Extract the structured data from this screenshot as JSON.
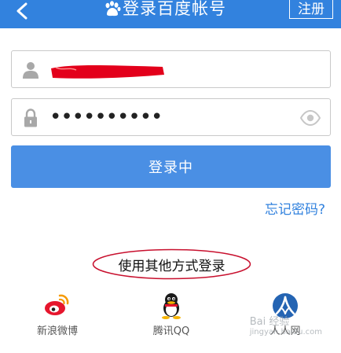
{
  "header": {
    "title": "登录百度帐号",
    "register_label": "注册",
    "background": "#3282de"
  },
  "form": {
    "username_value": "—",
    "password_value": "••••••••••",
    "login_button_label": "登录中",
    "forgot_link": "忘记密码?"
  },
  "other_login": {
    "label": "使用其他方式登录",
    "providers": [
      {
        "name": "新浪微博",
        "icon": "weibo-icon"
      },
      {
        "name": "腾讯QQ",
        "icon": "qq-icon"
      },
      {
        "name": "人人网",
        "icon": "renren-icon"
      }
    ]
  },
  "watermark": {
    "text": "Bai 经验",
    "subtext": "jingyan.baidu.com"
  },
  "colors": {
    "accent": "#3282de",
    "button": "#4a8fe4",
    "redact": "#e3001b",
    "annotation": "#c8102e"
  }
}
